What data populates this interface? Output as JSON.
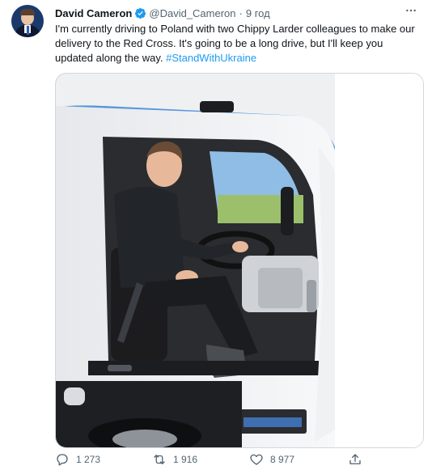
{
  "tweet": {
    "author_name": "David Cameron",
    "handle": "@David_Cameron",
    "separator": "·",
    "time": "9 год",
    "text_main": "I'm currently driving to Poland with two Chippy Larder colleagues to make our delivery to the Red Cross. It's going to be a long drive, but I'll keep you updated along the way. ",
    "hashtag": "#StandWithUkraine",
    "reply_count": "1 273",
    "retweet_count": "1 916",
    "like_count": "8 977"
  },
  "icons": {
    "verified": "verified-badge-icon",
    "more": "more-horizontal-icon",
    "reply": "reply-icon",
    "retweet": "retweet-icon",
    "like": "heart-icon",
    "share": "share-icon"
  },
  "colors": {
    "accent": "#1d9bf0",
    "text_primary": "#0f1419",
    "text_secondary": "#536471",
    "border": "#cfd9de"
  }
}
